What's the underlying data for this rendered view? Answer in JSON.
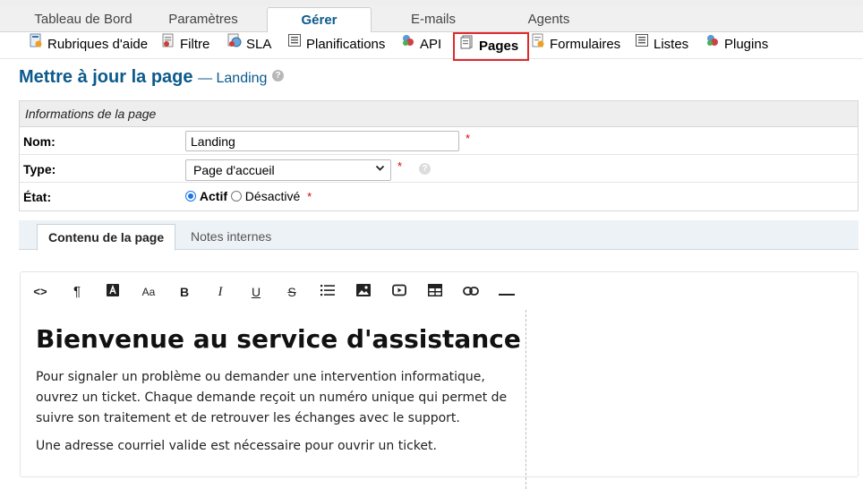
{
  "nav": {
    "tabs": [
      {
        "label": "Tableau de Bord"
      },
      {
        "label": "Paramètres"
      },
      {
        "label": "Gérer"
      },
      {
        "label": "E-mails"
      },
      {
        "label": "Agents"
      }
    ],
    "sub_items": [
      {
        "label": "Rubriques d'aide",
        "icon": "help-topics-icon"
      },
      {
        "label": "Filtre",
        "icon": "filter-icon"
      },
      {
        "label": "SLA",
        "icon": "sla-icon"
      },
      {
        "label": "Planifications",
        "icon": "schedule-icon"
      },
      {
        "label": "API",
        "icon": "api-icon"
      },
      {
        "label": "Pages",
        "icon": "pages-icon"
      },
      {
        "label": "Formulaires",
        "icon": "forms-icon"
      },
      {
        "label": "Listes",
        "icon": "lists-icon"
      },
      {
        "label": "Plugins",
        "icon": "plugins-icon"
      }
    ]
  },
  "page": {
    "title": "Mettre à jour la page",
    "subtitle": "— Landing"
  },
  "form": {
    "header": "Informations de la page",
    "name_label": "Nom:",
    "name_value": "Landing",
    "type_label": "Type:",
    "type_value": "Page d'accueil",
    "status_label": "État:",
    "status_active": "Actif",
    "status_disabled": "Désactivé",
    "required_mark": "*"
  },
  "content_tabs": {
    "content": "Contenu de la page",
    "notes": "Notes internes"
  },
  "editor": {
    "heading": "Bienvenue au service d'assistance",
    "paragraph1": "Pour signaler un problème ou demander une intervention informatique, ouvrez un ticket. Chaque demande reçoit un numéro unique qui permet de suivre son traitement et de retrouver les échanges avec le support.",
    "paragraph2": "Une adresse courriel valide est nécessaire pour ouvrir un ticket."
  },
  "colors": {
    "accent": "#0c5a8c",
    "highlight": "#e02a2a",
    "required": "#dd0000"
  }
}
